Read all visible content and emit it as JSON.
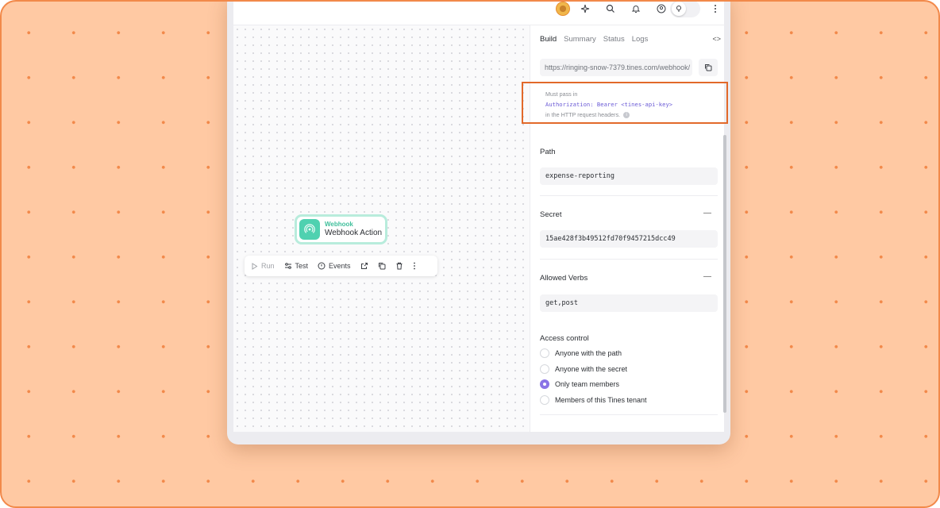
{
  "node": {
    "type": "Webhook",
    "name": "Webhook Action"
  },
  "toolbar": {
    "run": "Run",
    "test": "Test",
    "events": "Events"
  },
  "panel": {
    "tabs": [
      {
        "label": "Build",
        "active": true
      },
      {
        "label": "Summary",
        "active": false
      },
      {
        "label": "Status",
        "active": false
      },
      {
        "label": "Logs",
        "active": false
      }
    ],
    "code_toggle": "<>",
    "webhook_url": "https://ringing-snow-7379.tines.com/webhook/",
    "auth": {
      "line1": "Must pass in",
      "code": "Authorization: Bearer <tines-api-key>",
      "line3": "in the HTTP request headers."
    },
    "path": {
      "label": "Path",
      "value": "expense-reporting"
    },
    "secret": {
      "label": "Secret",
      "value": "15ae428f3b49512fd70f9457215dcc49"
    },
    "verbs": {
      "label": "Allowed Verbs",
      "value": "get,post"
    },
    "access": {
      "label": "Access control",
      "options": [
        {
          "label": "Anyone with the path",
          "checked": false
        },
        {
          "label": "Anyone with the secret",
          "checked": false
        },
        {
          "label": "Only team members",
          "checked": true
        },
        {
          "label": "Members of this Tines tenant",
          "checked": false
        }
      ]
    }
  },
  "colors": {
    "background": "#ffc9a3",
    "dots": "#f2894a",
    "accent": "#4fd1b0",
    "highlight_border": "#e2692a",
    "radio_checked": "#8a74e6"
  }
}
